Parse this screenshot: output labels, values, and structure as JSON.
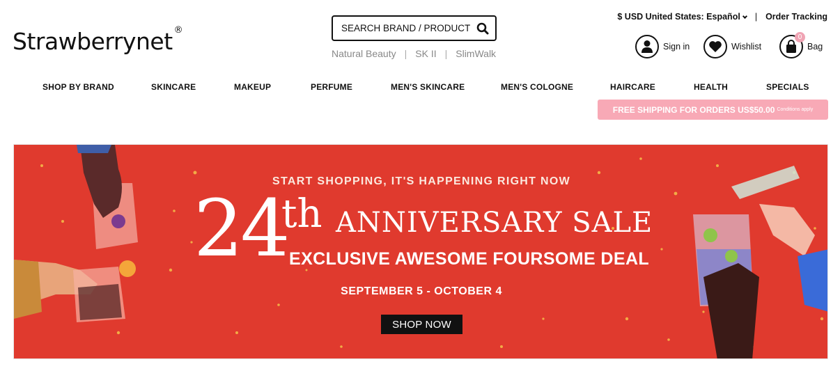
{
  "brand": {
    "name": "Strawberrynet",
    "mark": "®"
  },
  "search": {
    "placeholder": "SEARCH BRAND / PRODUCT"
  },
  "quick_links": [
    "Natural Beauty",
    "SK II",
    "SlimWalk"
  ],
  "locale": {
    "label": "$ USD United States: Español"
  },
  "order_tracking": "Order Tracking",
  "account": {
    "signin": "Sign in",
    "wishlist": "Wishlist",
    "bag": "Bag",
    "bag_count": "0"
  },
  "nav": [
    "SHOP BY BRAND",
    "SKINCARE",
    "MAKEUP",
    "PERFUME",
    "MEN'S SKINCARE",
    "MEN'S COLOGNE",
    "HAIRCARE",
    "HEALTH",
    "SPECIALS"
  ],
  "promo": {
    "text": "FREE SHIPPING FOR ORDERS US$50.00",
    "note": "Conditions apply"
  },
  "banner": {
    "kicker": "START SHOPPING, IT'S HAPPENING RIGHT NOW",
    "number": "24",
    "suffix": "th",
    "title": "ANNIVERSARY SALE",
    "subtitle": "EXCLUSIVE AWESOME FOURSOME DEAL",
    "dates": "SEPTEMBER 5 - OCTOBER 4",
    "cta": "SHOP NOW"
  },
  "colors": {
    "banner_bg": "#e03a2e",
    "promo_bg": "#f8a9b6",
    "cta_bg": "#111111"
  }
}
